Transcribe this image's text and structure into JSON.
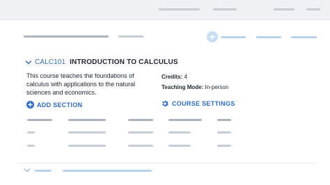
{
  "course": {
    "code": "CALC101",
    "title": "INTRODUCTION TO CALCULUS",
    "description": "This course teaches the foundations of calculus with applications to the natural sciences and economics.",
    "credits_label": "Credits:",
    "credits_value": "4",
    "mode_label": "Teaching Mode:",
    "mode_value": "In-person"
  },
  "actions": {
    "add_section": "ADD SECTION",
    "course_settings": "COURSE SETTINGS"
  },
  "colors": {
    "accent": "#2d6bd1",
    "topbar": "#eef0f4"
  },
  "icons": {
    "add": "plus-circle-icon",
    "settings": "gear-icon",
    "expand": "chevron-down-icon"
  }
}
